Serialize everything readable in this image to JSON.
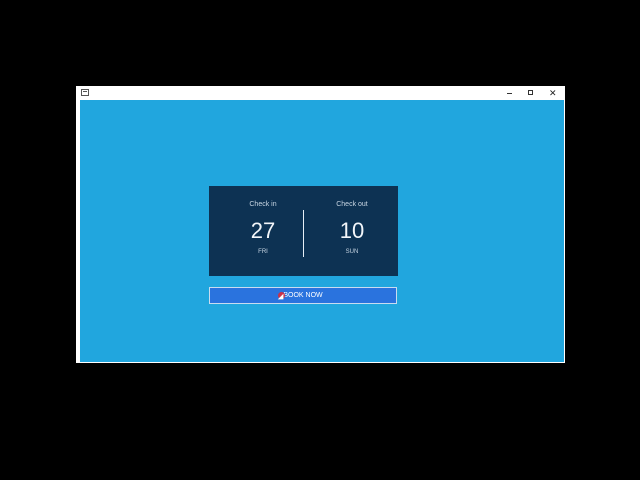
{
  "window": {
    "controls": {
      "minimize_icon": "minimize-icon",
      "maximize_icon": "maximize-icon",
      "close_icon": "close-icon",
      "close_glyph": "✕"
    }
  },
  "booking": {
    "check_in": {
      "label": "Check in",
      "day": "27",
      "weekday": "FRI"
    },
    "check_out": {
      "label": "Check out",
      "day": "10",
      "weekday": "SUN"
    },
    "book_button_label": "BOOK NOW"
  },
  "colors": {
    "background": "#21a6de",
    "card": "#0d3253",
    "button": "#2a73de"
  }
}
